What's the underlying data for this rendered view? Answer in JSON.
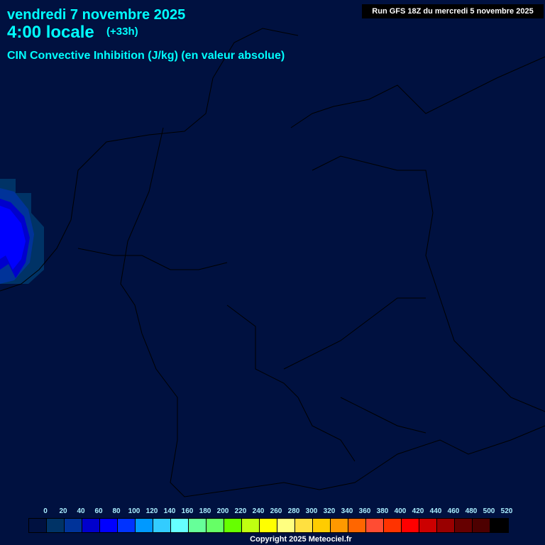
{
  "header": {
    "date": "vendredi 7 novembre 2025",
    "time": "4:00 locale",
    "offset": "(+33h)",
    "parameter": "CIN Convective Inhibition (J/kg) (en valeur absolue)",
    "run": "Run GFS 18Z du mercredi 5 novembre 2025"
  },
  "legend": {
    "labels": [
      "0",
      "20",
      "40",
      "60",
      "80",
      "100",
      "120",
      "140",
      "160",
      "180",
      "200",
      "220",
      "240",
      "260",
      "280",
      "300",
      "320",
      "340",
      "360",
      "380",
      "400",
      "420",
      "440",
      "460",
      "480",
      "500",
      "520"
    ],
    "colors": [
      "#001140",
      "#003366",
      "#003399",
      "#0000cc",
      "#0000ff",
      "#0033ff",
      "#0099ff",
      "#33ccff",
      "#66ffff",
      "#66ff99",
      "#66ff66",
      "#66ff00",
      "#c0ff11",
      "#ffff00",
      "#ffff80",
      "#ffe040",
      "#ffcc00",
      "#ff9900",
      "#ff6600",
      "#ff4c33",
      "#ff3300",
      "#ff0000",
      "#cc0000",
      "#990000",
      "#660000",
      "#4d0000",
      "#000000"
    ]
  },
  "copyright": "Copyright 2025 Meteociel.fr"
}
